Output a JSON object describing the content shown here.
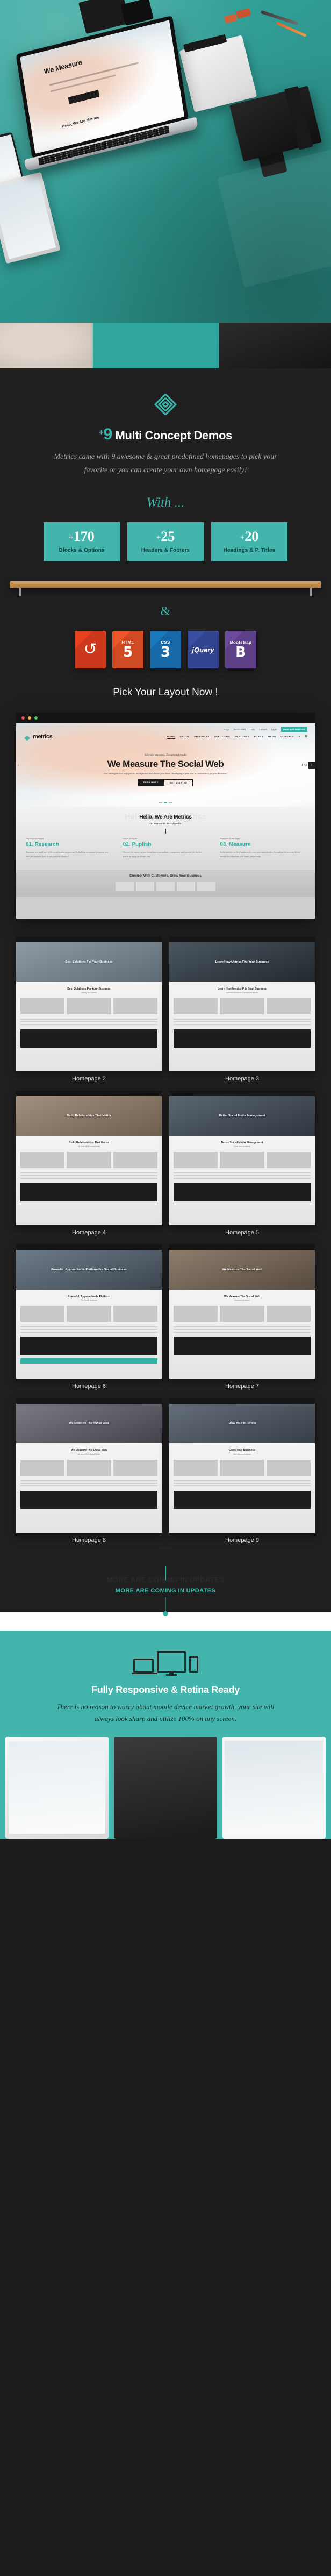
{
  "hero": {
    "laptop_screen_title": "We Measure",
    "laptop_screen_mid": "Hello, We Are Metrics"
  },
  "intro": {
    "logo_alt": "metrics-logo",
    "plus": "+",
    "count": "9",
    "title": "Multi Concept Demos",
    "description": "Metrics came with 9 awesome & great predefined homepages to pick your favorite or you can create your own homepage easily!",
    "with_label": "With ...",
    "ampersand": "&",
    "pick_label": "Pick Your Layout Now !"
  },
  "counters": [
    {
      "plus": "+",
      "value": "170",
      "label": "Blocks & Options"
    },
    {
      "plus": "+",
      "value": "25",
      "label": "Headers & Footers"
    },
    {
      "plus": "+",
      "value": "20",
      "label": "Headings & P. Titles"
    }
  ],
  "tech_badges": [
    {
      "name": "responsive-icon",
      "tiny": "",
      "big": "↻",
      "color": "#e8401f"
    },
    {
      "name": "html5-icon",
      "tiny": "HTML",
      "big": "5",
      "color": "#ed5628"
    },
    {
      "name": "css3-icon",
      "tiny": "CSS",
      "big": "3",
      "color": "#1b79bf"
    },
    {
      "name": "jquery-icon",
      "tiny": "",
      "big": "jQuery",
      "color": "#3a4ea4"
    },
    {
      "name": "bootstrap-icon",
      "tiny": "Bootstrap",
      "big": "B",
      "color": "#6b499b"
    }
  ],
  "browser_preview": {
    "nav_top": [
      "FAQs",
      "Testimonials",
      "Help",
      "Careers",
      "Login"
    ],
    "seo_button": "FREE SEO ANALYSIS",
    "brand": "metrics",
    "nav_links": [
      "HOME",
      "ABOUT",
      "PRODUCTS",
      "SOLUTIONS",
      "FEATURES",
      "PLANS",
      "BLOG",
      "CONTACT"
    ],
    "search_icon": "⌕",
    "menu_icon": "☰",
    "pre_heading": "Informed decisions. Exceptional results",
    "heading": "We Measure The Social Web",
    "sub": "Our strategists will help you set an objective and choose your tools, developing a plan that is custom-built for your business.",
    "btn_primary": "READ MORE",
    "btn_secondary": "GET STARTED",
    "slide_counter": "1 / 3",
    "prev_icon": "‹",
    "next_icon": "›",
    "section_heading": "Hello, We Are Metrics",
    "section_sub": "Do More With Social Media",
    "columns": [
      {
        "tag": "Get Unique Insight",
        "num": "01.",
        "title": "Research",
        "body": "Execution is a small part of the social marketing process. To build an exceptional program, you must put analytics first. So you just need Metrics !"
      },
      {
        "tag": "Value of Social",
        "num": "02.",
        "title": "Puplish",
        "body": "Uncover the impact of your brand tactics on audience engagement and optimize for the best results by using the Metrics way."
      },
      {
        "tag": "Analytics Done Right",
        "num": "03.",
        "title": "Measure",
        "body": "Social analytics is the foundation for every informed decision, throughout the process. Social analytics will increase your team's productivity."
      }
    ],
    "cta_heading": "Connect With Customers, Grow Your Business"
  },
  "gallery": {
    "rows": [
      [
        {
          "label": "Homepage 2",
          "banner_text": "Best Solutions For Your Business",
          "mini_h": "Best Solutions For Your Business",
          "mini_s": "Satisfy Your Needs",
          "hue": "#6e7f8c"
        },
        {
          "label": "Homepage 3",
          "banner_text": "Learn How Metrics Fits Your Business",
          "mini_h": "Learn How Metrics Fits Your Business",
          "mini_s": "Informed decisions. Exceptional results",
          "hue": "#3e4b55"
        }
      ],
      [
        {
          "label": "Homepage 4",
          "banner_text": "Build Relationships That Matter",
          "mini_h": "Build Relationships That Matter",
          "mini_s": "Do More With Social Media",
          "hue": "#8a7a6b"
        },
        {
          "label": "Homepage 5",
          "banner_text": "Better Social Media Management",
          "mini_h": "Better Social Media Management",
          "mini_s": "Grow Your Audience",
          "hue": "#4a5561"
        }
      ],
      [
        {
          "label": "Homepage 6",
          "banner_text": "Powerful, Approachable Platform For Social Business",
          "mini_h": "Powerful, Approachable Platform",
          "mini_s": "For Social Business",
          "hue": "#5d6b78"
        },
        {
          "label": "Homepage 7",
          "banner_text": "We Measure The Social Web",
          "mini_h": "We Measure The Social Web",
          "mini_s": "Informed decisions",
          "hue": "#7b6a5c"
        }
      ],
      [
        {
          "label": "Homepage 8",
          "banner_text": "We Measure The Social Web",
          "mini_h": "We Measure The Social Web",
          "mini_s": "Do More With Social Media",
          "hue": "#6a6a72"
        },
        {
          "label": "Homepage 9",
          "banner_text": "Grow Your Business",
          "mini_h": "Grow Your Business",
          "mini_s": "With Metrics Analytics",
          "hue": "#55606b"
        }
      ]
    ],
    "more_label": "MORE ARE COMING IN UPDATES",
    "more_ghost": "MORE ARE COMING IN UPDATES"
  },
  "responsive": {
    "devices": [
      "laptop-icon",
      "desktop-icon",
      "mobile-icon"
    ],
    "title": "Fully Responsive & Retina Ready",
    "description": "There is no reason to worry about mobile device market growth, your site will always look sharp and utilize 100% on any screen."
  },
  "colors": {
    "teal": "#44b5ac",
    "teal_text": "#3bb5ab",
    "dark": "#1f1f1f"
  }
}
